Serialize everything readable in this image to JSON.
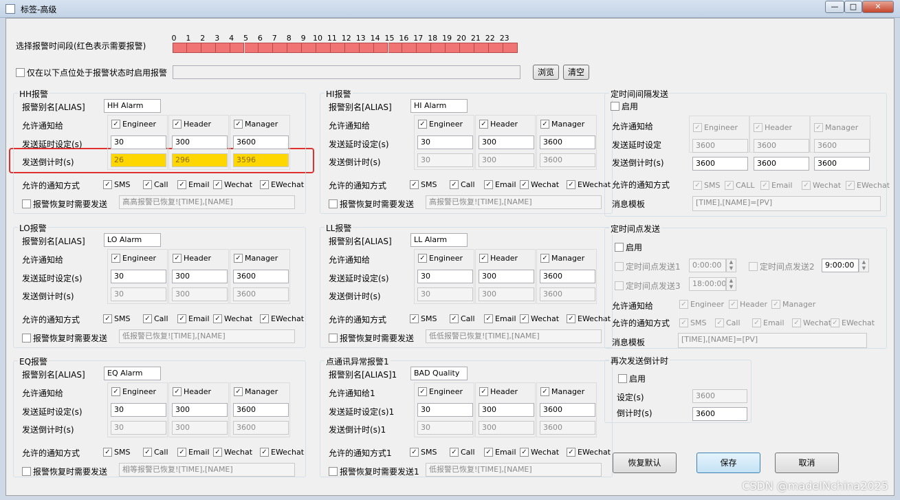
{
  "window": {
    "title": "标签-高级",
    "min": "—",
    "max": "□",
    "close": "✕"
  },
  "hours": {
    "label": "选择报警时间段(红色表示需要报警)",
    "values": [
      "0",
      "1",
      "2",
      "3",
      "4",
      "5",
      "6",
      "7",
      "8",
      "9",
      "10",
      "11",
      "12",
      "13",
      "14",
      "15",
      "16",
      "17",
      "18",
      "19",
      "20",
      "21",
      "22",
      "23"
    ]
  },
  "point_option": {
    "label": "仅在以下点位处于报警状态时启用报警",
    "value": "",
    "browse": "浏览",
    "clear": "清空"
  },
  "common": {
    "alias": "报警别名[ALIAS]",
    "notify": "允许通知给",
    "delay": "发送延时设定(s)",
    "countdown": "发送倒计时(s)",
    "methods": "允许的通知方式",
    "recover": "报警恢复时需要发送",
    "engineer": "Engineer",
    "header": "Header",
    "manager": "Manager",
    "sms": "SMS",
    "call": "Call",
    "email": "Email",
    "wechat": "Wechat",
    "ewechat": "EWechat"
  },
  "hh": {
    "title": "HH报警",
    "alias": "HH Alarm",
    "d1": "30",
    "d2": "300",
    "d3": "3600",
    "c1": "26",
    "c2": "296",
    "c3": "3596",
    "recover_text": "高高报警已恢复![TIME],[NAME]"
  },
  "hi": {
    "title": "HI报警",
    "alias": "HI Alarm",
    "d1": "30",
    "d2": "300",
    "d3": "3600",
    "c1": "30",
    "c2": "300",
    "c3": "3600",
    "recover_text": "高报警已恢复![TIME],[NAME]"
  },
  "lo": {
    "title": "LO报警",
    "alias": "LO Alarm",
    "d1": "30",
    "d2": "300",
    "d3": "3600",
    "c1": "30",
    "c2": "300",
    "c3": "3600",
    "recover_text": "低报警已恢复![TIME],[NAME]"
  },
  "ll": {
    "title": "LL报警",
    "alias": "LL Alarm",
    "d1": "30",
    "d2": "300",
    "d3": "3600",
    "c1": "30",
    "c2": "300",
    "c3": "3600",
    "recover_text": "低低报警已恢复![TIME],[NAME]"
  },
  "eq": {
    "title": "EQ报警",
    "alias": "EQ Alarm",
    "d1": "30",
    "d2": "300",
    "d3": "3600",
    "c1": "30",
    "c2": "300",
    "c3": "3600",
    "recover_text": "相等报警已恢复![TIME],[NAME]"
  },
  "bad": {
    "title": "点通讯异常报警1",
    "alias_label": "报警别名[ALIAS]1",
    "alias": "BAD Quality",
    "notify": "允许通知给1",
    "delay": "发送延时设定(s)1",
    "countdown": "发送倒计时(s)1",
    "methods": "允许的通知方式1",
    "recover": "报警恢复时需要发送1",
    "d1": "30",
    "d2": "300",
    "d3": "3600",
    "c1": "30",
    "c2": "300",
    "c3": "3600",
    "recover_text": "低报警已恢复![TIME],[NAME]"
  },
  "interval": {
    "title": "定时间间隔发送",
    "enable": "启用",
    "notify": "允许通知给",
    "delay": "发送延时设定",
    "countdown": "发送倒计时(s)",
    "methods": "允许的通知方式",
    "template_label": "消息模板",
    "d1": "3600",
    "d2": "3600",
    "d3": "3600",
    "c1": "3600",
    "c2": "3600",
    "c3": "3600",
    "sms": "SMS",
    "call": "CALL",
    "email": "Email",
    "wechat": "Wechat",
    "ewechat": "EWechat",
    "template": "[TIME],[NAME]=[PV]"
  },
  "timepoint": {
    "title": "定时间点发送",
    "enable": "启用",
    "p1_label": "定时间点发送1",
    "p1": "0:00:00",
    "p2_label": "定时间点发送2",
    "p2": "9:00:00",
    "p3_label": "定时间点发送3",
    "p3": "18:00:00",
    "notify": "允许通知给",
    "methods": "允许的通知方式",
    "template_label": "消息模板",
    "template": "[TIME],[NAME]=[PV]"
  },
  "resend": {
    "title": "再次发送倒计时",
    "enable": "启用",
    "setting_label": "设定(s)",
    "setting": "3600",
    "countdown_label": "倒计时(s)",
    "countdown": "3600"
  },
  "buttons": {
    "restore": "恢复默认",
    "save": "保存",
    "cancel": "取消"
  },
  "watermark": "CSDN @madeINchina2025",
  "colors": {
    "hour_bar": "#f07474",
    "countdown_hh": "#ffd700",
    "highlight": "#e0302d"
  }
}
